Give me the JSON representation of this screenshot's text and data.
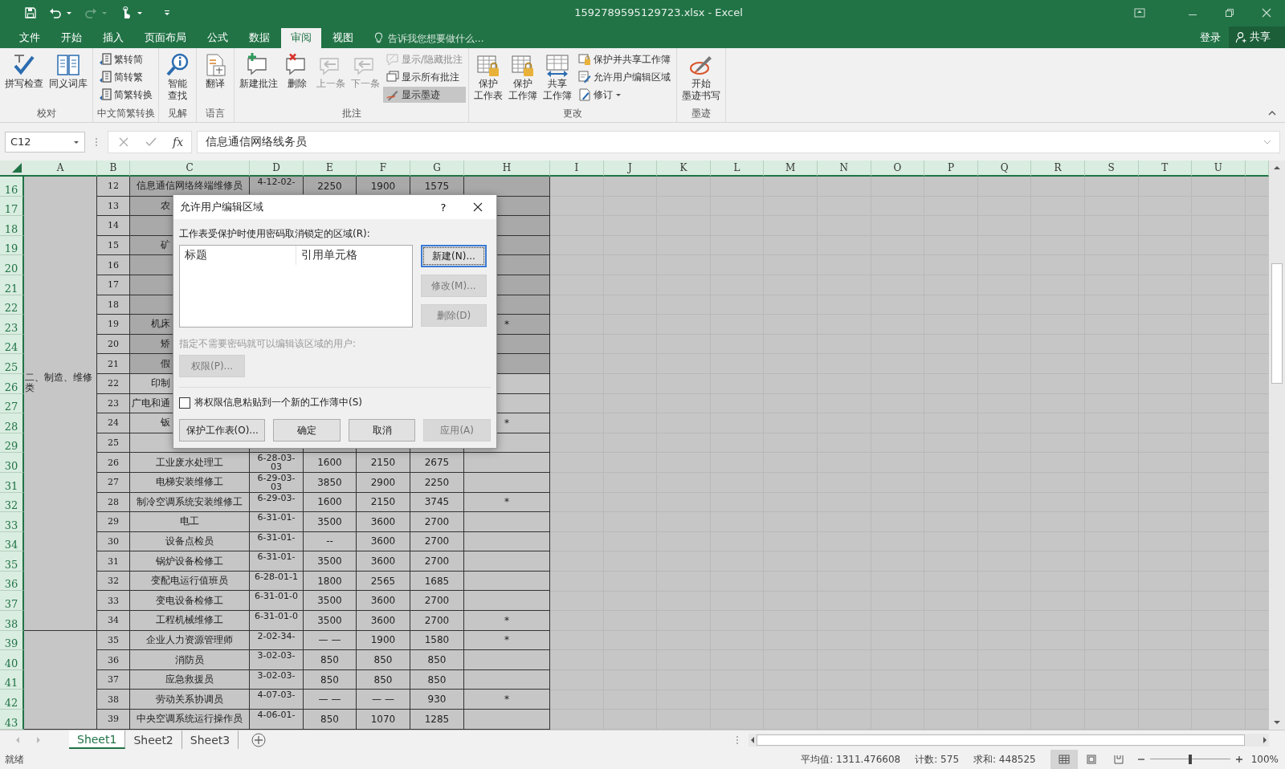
{
  "window": {
    "title": "1592789595129723.xlsx - Excel"
  },
  "menu_tabs": [
    {
      "label": "文件",
      "selected": false
    },
    {
      "label": "开始",
      "selected": false
    },
    {
      "label": "插入",
      "selected": false
    },
    {
      "label": "页面布局",
      "selected": false
    },
    {
      "label": "公式",
      "selected": false
    },
    {
      "label": "数据",
      "selected": false
    },
    {
      "label": "审阅",
      "selected": true
    },
    {
      "label": "视图",
      "selected": false
    }
  ],
  "tell_me": {
    "placeholder": "告诉我您想要做什么..."
  },
  "account": {
    "sign_in": "登录",
    "share": "共享"
  },
  "ribbon": {
    "groups": [
      {
        "label": "校对",
        "buttons": [
          {
            "lines": [
              "拼写检查"
            ],
            "kind": "large",
            "disabled": false,
            "on": false,
            "dropdown": false
          },
          {
            "lines": [
              "同义词库"
            ],
            "kind": "large",
            "disabled": false,
            "on": false,
            "dropdown": false
          }
        ]
      },
      {
        "label": "中文简繁转换",
        "buttons": [
          {
            "label": "繁转简",
            "kind": "small",
            "disabled": false,
            "on": false,
            "dropdown": false
          },
          {
            "label": "简转繁",
            "kind": "small",
            "disabled": false,
            "on": false,
            "dropdown": false
          },
          {
            "label": "简繁转换",
            "kind": "small",
            "disabled": false,
            "on": false,
            "dropdown": false
          }
        ]
      },
      {
        "label": "见解",
        "buttons": [
          {
            "lines": [
              "智能",
              "查找"
            ],
            "kind": "large",
            "disabled": false,
            "on": false,
            "dropdown": false
          }
        ]
      },
      {
        "label": "语言",
        "buttons": [
          {
            "lines": [
              "翻译"
            ],
            "kind": "large",
            "disabled": false,
            "on": false,
            "dropdown": false
          }
        ]
      },
      {
        "label": "批注",
        "buttons": [
          {
            "lines": [
              "新建批注"
            ],
            "kind": "large",
            "disabled": false,
            "on": false,
            "dropdown": false
          },
          {
            "lines": [
              "删除"
            ],
            "kind": "large",
            "disabled": false,
            "on": false,
            "dropdown": false
          },
          {
            "lines": [
              "上一条"
            ],
            "kind": "large",
            "disabled": true,
            "on": false,
            "dropdown": false
          },
          {
            "lines": [
              "下一条"
            ],
            "kind": "large",
            "disabled": true,
            "on": false,
            "dropdown": false
          },
          {
            "label": "显示/隐藏批注",
            "kind": "small",
            "disabled": true,
            "on": false,
            "dropdown": false
          },
          {
            "label": "显示所有批注",
            "kind": "small",
            "disabled": false,
            "on": false,
            "dropdown": false
          },
          {
            "label": "显示墨迹",
            "kind": "small",
            "disabled": false,
            "on": true,
            "dropdown": false
          }
        ]
      },
      {
        "label": "更改",
        "buttons": [
          {
            "lines": [
              "保护",
              "工作表"
            ],
            "kind": "large",
            "disabled": false,
            "on": false,
            "dropdown": false
          },
          {
            "lines": [
              "保护",
              "工作簿"
            ],
            "kind": "large",
            "disabled": false,
            "on": false,
            "dropdown": false
          },
          {
            "lines": [
              "共享",
              "工作簿"
            ],
            "kind": "large",
            "disabled": false,
            "on": false,
            "dropdown": false
          },
          {
            "label": "保护并共享工作簿",
            "kind": "small",
            "disabled": false,
            "on": false,
            "dropdown": false
          },
          {
            "label": "允许用户编辑区域",
            "kind": "small",
            "disabled": false,
            "on": false,
            "dropdown": false
          },
          {
            "label": "修订",
            "kind": "small",
            "disabled": false,
            "on": false,
            "dropdown": true
          }
        ]
      },
      {
        "label": "墨迹",
        "buttons": [
          {
            "lines": [
              "开始",
              "墨迹书写"
            ],
            "kind": "large",
            "disabled": false,
            "on": false,
            "dropdown": false
          }
        ]
      }
    ]
  },
  "formula_bar": {
    "name_box": "C12",
    "function_label": "fx",
    "formula": "信息通信网络线务员"
  },
  "sheet": {
    "columns": [
      "A",
      "B",
      "C",
      "D",
      "E",
      "F",
      "G",
      "H",
      "I",
      "J",
      "K",
      "L",
      "M",
      "N",
      "O",
      "P",
      "Q",
      "R",
      "S",
      "T",
      "U"
    ],
    "row_groups": [
      {
        "A": "二、制造、维修类",
        "rows": [
          {
            "row": "16",
            "B": "12",
            "C": "信息通信网络终端维修员",
            "D": [
              "4-12-02-"
            ],
            "E": "2250",
            "F": "1900",
            "G": "1575",
            "highlighted": true
          },
          {
            "row": "17",
            "B": "13",
            "C": "农",
            "highlighted": true
          },
          {
            "row": "18",
            "B": "14",
            "highlighted": true
          },
          {
            "row": "19",
            "B": "15",
            "C": "矿",
            "highlighted": true
          },
          {
            "row": "20",
            "B": "16",
            "highlighted": true
          },
          {
            "row": "21",
            "B": "17",
            "highlighted": true
          },
          {
            "row": "22",
            "B": "18",
            "highlighted": true
          },
          {
            "row": "23",
            "B": "19",
            "C": "机床",
            "H": "*",
            "highlighted": true
          },
          {
            "row": "24",
            "B": "20",
            "C": "矫",
            "highlighted": true
          },
          {
            "row": "25",
            "B": "21",
            "C": "假",
            "highlighted": true
          },
          {
            "row": "26",
            "B": "22",
            "C": "印制",
            "highlighted": false
          },
          {
            "row": "27",
            "B": "23",
            "C": "广电和通",
            "highlighted": false
          },
          {
            "row": "28",
            "B": "24",
            "C": "钣",
            "H": "*",
            "highlighted": false
          },
          {
            "row": "29",
            "B": "25",
            "highlighted": false
          },
          {
            "row": "30",
            "B": "26",
            "C": "工业废水处理工",
            "D": [
              "6-28-03-",
              "03"
            ],
            "E": "1600",
            "F": "2150",
            "G": "2675",
            "highlighted": false
          },
          {
            "row": "31",
            "B": "27",
            "C": "电梯安装维修工",
            "D": [
              "6-29-03-",
              "03"
            ],
            "E": "3850",
            "F": "2900",
            "G": "2250",
            "highlighted": false
          },
          {
            "row": "32",
            "B": "28",
            "C": "制冷空调系统安装维修工",
            "D": [
              "6-29-03-"
            ],
            "E": "1600",
            "F": "2150",
            "G": "3745",
            "H": "*",
            "highlighted": false
          },
          {
            "row": "33",
            "B": "29",
            "C": "电工",
            "D": [
              "6-31-01-"
            ],
            "E": "3500",
            "F": "3600",
            "G": "2700",
            "highlighted": false
          },
          {
            "row": "34",
            "B": "30",
            "C": "设备点检员",
            "D": [
              "6-31-01-"
            ],
            "E": "--",
            "F": "3600",
            "G": "2700",
            "highlighted": false
          },
          {
            "row": "35",
            "B": "31",
            "C": "锅炉设备检修工",
            "D": [
              "6-31-01-"
            ],
            "E": "3500",
            "F": "3600",
            "G": "2700",
            "highlighted": false
          },
          {
            "row": "36",
            "B": "32",
            "C": "变配电运行值班员",
            "D": [
              "6-28-01-1"
            ],
            "E": "1800",
            "F": "2565",
            "G": "1685",
            "highlighted": false
          },
          {
            "row": "37",
            "B": "33",
            "C": "变电设备检修工",
            "D": [
              "6-31-01-0"
            ],
            "E": "3500",
            "F": "3600",
            "G": "2700",
            "highlighted": false
          },
          {
            "row": "38",
            "B": "34",
            "C": "工程机械维修工",
            "D": [
              "6-31-01-0"
            ],
            "E": "3500",
            "F": "3600",
            "G": "2700",
            "H": "*",
            "highlighted": false
          }
        ]
      },
      {
        "rows": [
          {
            "row": "39",
            "B": "35",
            "C": "企业人力资源管理师",
            "D": [
              "2-02-34-"
            ],
            "E": "— —",
            "F": "1900",
            "G": "1580",
            "H": "*",
            "highlighted": false
          },
          {
            "row": "40",
            "B": "36",
            "C": "消防员",
            "D": [
              "3-02-03-"
            ],
            "E": "850",
            "F": "850",
            "G": "850",
            "highlighted": false
          },
          {
            "row": "41",
            "B": "37",
            "C": "应急救援员",
            "D": [
              "3-02-03-"
            ],
            "E": "850",
            "F": "850",
            "G": "850",
            "highlighted": false
          },
          {
            "row": "42",
            "B": "38",
            "C": "劳动关系协调员",
            "D": [
              "4-07-03-"
            ],
            "E": "— —",
            "F": "— —",
            "G": "930",
            "H": "*",
            "highlighted": false
          },
          {
            "row": "43",
            "B": "39",
            "C": "中央空调系统运行操作员",
            "D": [
              "4-06-01-"
            ],
            "E": "850",
            "F": "1070",
            "G": "1285",
            "highlighted": false
          }
        ]
      }
    ]
  },
  "dialog": {
    "title": "允许用户编辑区域",
    "help": "?",
    "ranges_label": "工作表受保护时使用密码取消锁定的区域(R):",
    "list_columns": [
      "标题",
      "引用单元格"
    ],
    "side_buttons": [
      {
        "label": "新建(N)...",
        "disabled": false,
        "focused": true
      },
      {
        "label": "修改(M)...",
        "disabled": true,
        "focused": false
      },
      {
        "label": "删除(D)",
        "disabled": true,
        "focused": false
      }
    ],
    "users_label": "指定不需要密码就可以编辑该区域的用户:",
    "users_disabled": true,
    "permissions_button": {
      "label": "权限(P)...",
      "disabled": true
    },
    "paste_checkbox": {
      "label": "将权限信息粘贴到一个新的工作薄中(S)",
      "checked": false
    },
    "buttons": [
      {
        "label": "保护工作表(O)...",
        "disabled": false
      },
      {
        "label": "确定",
        "disabled": false
      },
      {
        "label": "取消",
        "disabled": false
      },
      {
        "label": "应用(A)",
        "disabled": true
      }
    ]
  },
  "sheet_tabs": [
    {
      "label": "Sheet1",
      "selected": true
    },
    {
      "label": "Sheet2",
      "selected": false
    },
    {
      "label": "Sheet3",
      "selected": false
    }
  ],
  "status_bar": {
    "status": "就绪",
    "average": "平均值: 1311.476608",
    "count": "计数: 575",
    "sum": "求和: 448525",
    "views": [
      {
        "selected": true
      },
      {
        "selected": false
      },
      {
        "selected": false
      }
    ],
    "zoom": {
      "level": 0.5,
      "label": "100%"
    }
  }
}
